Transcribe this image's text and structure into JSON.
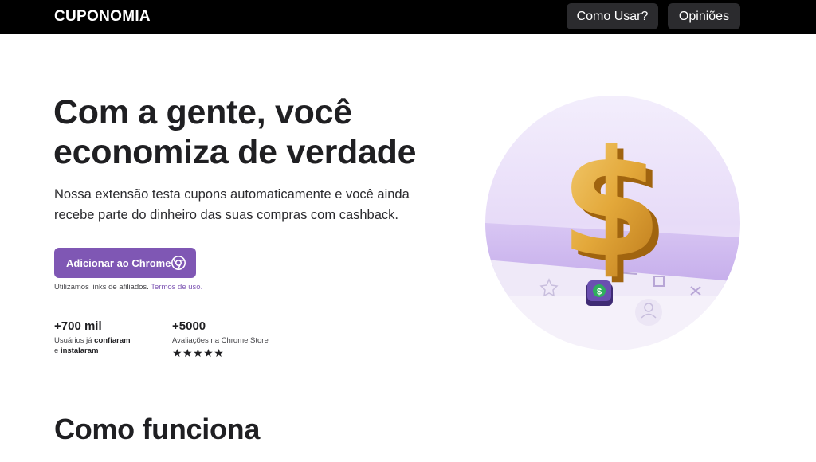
{
  "header": {
    "logo": "CUPONOMIA",
    "nav": [
      {
        "label": "Como Usar?"
      },
      {
        "label": "Opiniões"
      }
    ]
  },
  "hero": {
    "title": "Com a gente, você economiza de verdade",
    "subtitle": "Nossa extensão testa cupons automaticamente e você ainda recebe parte do dinheiro das suas compras com cashback.",
    "cta_label": "Adicionar ao Chrome",
    "cta_icon": "chrome-icon",
    "affiliate_text": "Utilizamos links de afiliados.",
    "affiliate_link": "Termos de uso."
  },
  "stats": [
    {
      "number": "+700 mil",
      "label_parts": [
        "Usuários já ",
        "confiaram",
        "e ",
        "instalaram"
      ]
    },
    {
      "number": "+5000",
      "label": "Avaliações na Chrome Store",
      "stars": "★★★★★",
      "rating": 5
    }
  ],
  "illustration": {
    "symbol": "$",
    "icon": "dollar-sign-icon"
  },
  "section": {
    "title": "Como funciona"
  },
  "colors": {
    "topbar": "#000000",
    "nav_button": "#2b2b2e",
    "accent": "#7f57b4",
    "circle_bg": "#eee6fb",
    "coin_gold": "#d99a2b"
  }
}
